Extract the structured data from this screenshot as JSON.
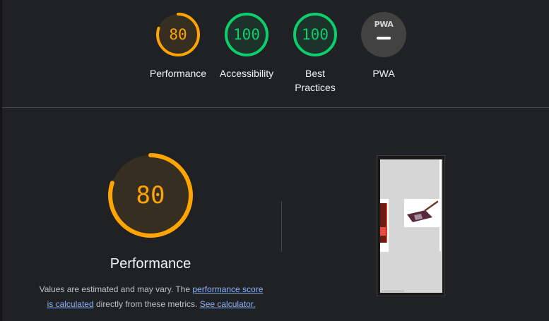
{
  "categories": [
    {
      "name": "Performance",
      "score": "80",
      "fraction": 0.8,
      "status": "average"
    },
    {
      "name": "Accessibility",
      "score": "100",
      "fraction": 1.0,
      "status": "pass"
    },
    {
      "name": "Best Practices",
      "label_lines": [
        "Best",
        "Practices"
      ],
      "score": "100",
      "fraction": 1.0,
      "status": "pass"
    },
    {
      "name": "PWA",
      "badge_text": "PWA"
    }
  ],
  "performance": {
    "score": "80",
    "fraction": 0.8,
    "title": "Performance",
    "description_prefix": "Values are estimated and may vary. The ",
    "link_score": "performance score",
    "link_calculated": "is calculated",
    "description_middle": " directly from these metrics. ",
    "link_calculator": "See calculator."
  },
  "colors": {
    "background": "#202124",
    "average": "#ffa400",
    "pass": "#0cce6b",
    "pwa_badge": "#424242",
    "link": "#8ab4f8"
  },
  "icons": {
    "pwa": "pwa-badge-icon",
    "screenshot": "page-screenshot-thumbnail"
  }
}
